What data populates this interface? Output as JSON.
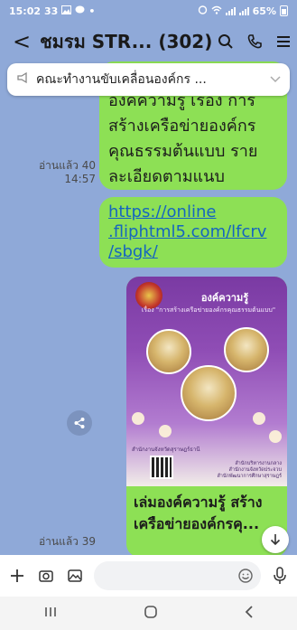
{
  "status_bar": {
    "time": "15:02",
    "notif_count": "33",
    "battery": "65%"
  },
  "header": {
    "back_symbol": "<",
    "title": "ชมรม STR... (302)"
  },
  "announcement": {
    "text": "คณะทำงานขับเคลื่อนองค์กร ..."
  },
  "messages": [
    {
      "lines": [
        "องค์ความรู้ เรื่อง การ",
        "สร้างเครือข่ายองค์กร",
        "คุณธรรมต้นแบบ ราย",
        "ละเอียดตามแนบ"
      ],
      "read_label": "อ่านแล้ว 40",
      "time": "14:57"
    },
    {
      "link_lines": [
        "https://online",
        ".fliphtml5.com/lfcrv",
        "/sbgk/"
      ]
    },
    {
      "poster_title": "องค์ความรู้",
      "poster_subtitle": "เรื่อง \"การสร้างเครือข่ายองค์กรคุณธรรมต้นแบบ\"",
      "poster_org": "สำนักงานจังหวัดสุราษฎร์ธานี",
      "poster_side": [
        "สำนักบริหารงานกลาง",
        "สำนักงานจังหวัดประจวบ",
        "สำนักพัฒนาการศึกษาสุราษฎร์"
      ],
      "caption_lines": [
        "เล่มองค์ความรู้ สร้าง",
        "เครือข่ายองค์กรคุ..."
      ],
      "read_label": "อ่านแล้ว 39"
    }
  ],
  "input": {
    "placeholder": ""
  },
  "colors": {
    "chat_bg": "#8fa9d8",
    "bubble": "#8de055",
    "link": "#1565c0"
  }
}
